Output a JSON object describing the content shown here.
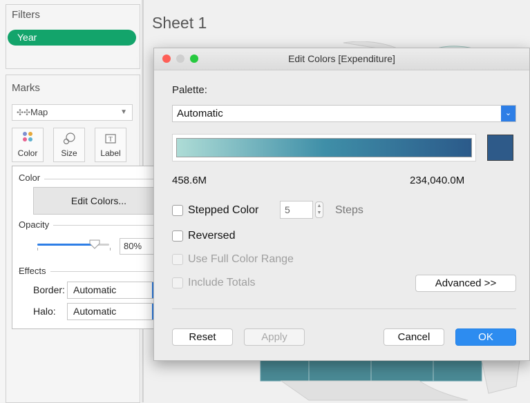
{
  "left_panel": {
    "filters": {
      "title": "Filters",
      "pill": "Year"
    },
    "marks": {
      "title": "Marks",
      "mark_type": "Map",
      "buttons": [
        {
          "label": "Color",
          "icon": "color-dots-icon"
        },
        {
          "label": "Size",
          "icon": "size-icon"
        },
        {
          "label": "Label",
          "icon": "label-icon"
        }
      ]
    },
    "color_popup": {
      "color_section": "Color",
      "edit_colors_button": "Edit Colors...",
      "opacity_section": "Opacity",
      "opacity_value": "80%",
      "opacity_fraction": 0.8,
      "effects_section": "Effects",
      "border_label": "Border:",
      "border_value": "Automatic",
      "halo_label": "Halo:",
      "halo_value": "Automatic"
    }
  },
  "sheet": {
    "title": "Sheet 1"
  },
  "dialog": {
    "title": "Edit Colors [Expenditure]",
    "palette_label": "Palette:",
    "palette_value": "Automatic",
    "ramp": {
      "start_color": "#aedcd6",
      "mid_color": "#3f8fa8",
      "end_color": "#2b5a8a"
    },
    "swatch_color": "#2e5a89",
    "range_min": "458.6M",
    "range_max": "234,040.0M",
    "stepped_color_label": "Stepped Color",
    "steps_value": "5",
    "steps_label": "Steps",
    "reversed_label": "Reversed",
    "full_range_label": "Use Full Color Range",
    "include_totals_label": "Include Totals",
    "advanced_button": "Advanced >>",
    "reset_button": "Reset",
    "apply_button": "Apply",
    "cancel_button": "Cancel",
    "ok_button": "OK"
  },
  "colors": {
    "accent": "#2d8cf0",
    "pill_green": "#13a46b",
    "traffic_red": "#fe5f57",
    "traffic_gray": "#cfcfcf",
    "traffic_green": "#27c93f"
  }
}
